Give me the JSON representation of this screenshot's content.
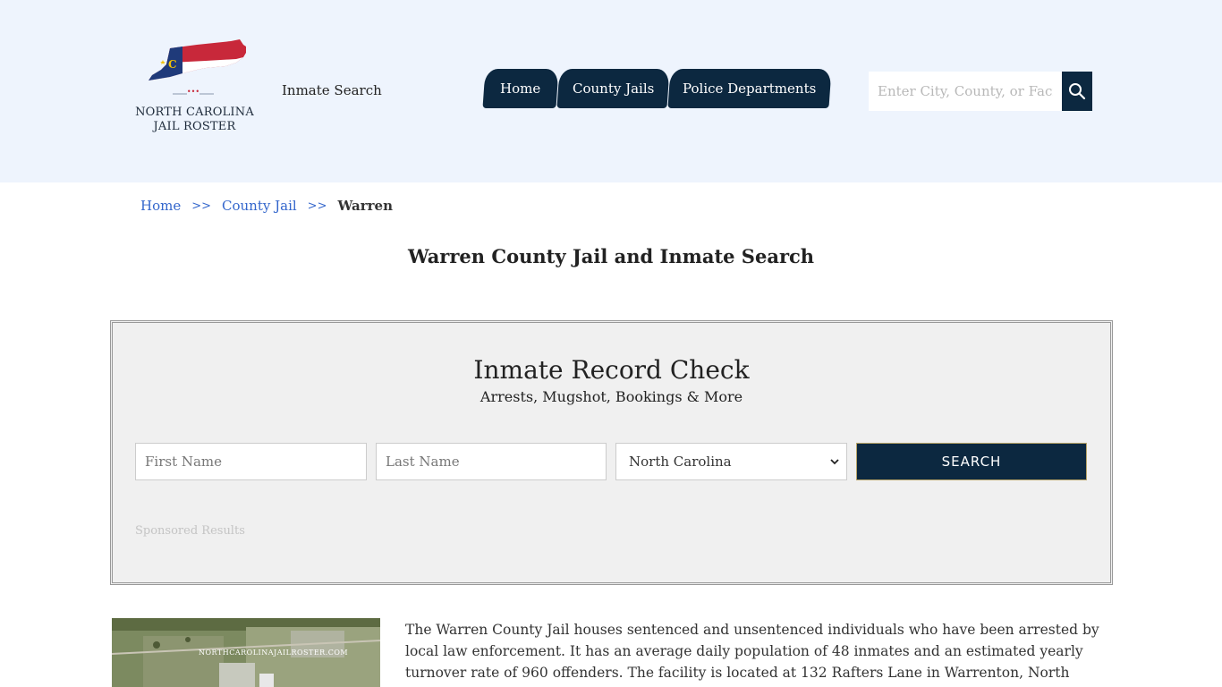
{
  "header": {
    "logo_line1": "NORTH CAROLINA",
    "logo_line2": "JAIL ROSTER",
    "logo_dots": "•••",
    "tagline": "Inmate Search",
    "nav": [
      {
        "label": "Home"
      },
      {
        "label": "County Jails"
      },
      {
        "label": "Police Departments"
      }
    ],
    "search_placeholder": "Enter City, County, or Facility"
  },
  "breadcrumb": {
    "home": "Home",
    "sep": ">>",
    "county_jail": "County Jail",
    "current": "Warren"
  },
  "page_title": "Warren County Jail and Inmate Search",
  "record_check": {
    "title": "Inmate Record Check",
    "subtitle": "Arrests, Mugshot, Bookings & More",
    "first_name_placeholder": "First Name",
    "last_name_placeholder": "Last Name",
    "state_value": "North Carolina",
    "search_label": "SEARCH",
    "sponsored": "Sponsored Results"
  },
  "facility": {
    "image_watermark": "NORTHCAROLINAJAILROSTER.COM",
    "description": "The Warren County Jail houses sentenced and unsentenced individuals who have been arrested by local law enforcement. It has an average daily population of 48 inmates and an estimated yearly turnover rate of 960 offenders. The facility is located at 132 Rafters Lane in Warrenton, North Carolina."
  },
  "colors": {
    "header_bg": "#eef4fd",
    "navy": "#0c2840",
    "link": "#3366cc",
    "panel_bg": "#f0f0f0"
  }
}
